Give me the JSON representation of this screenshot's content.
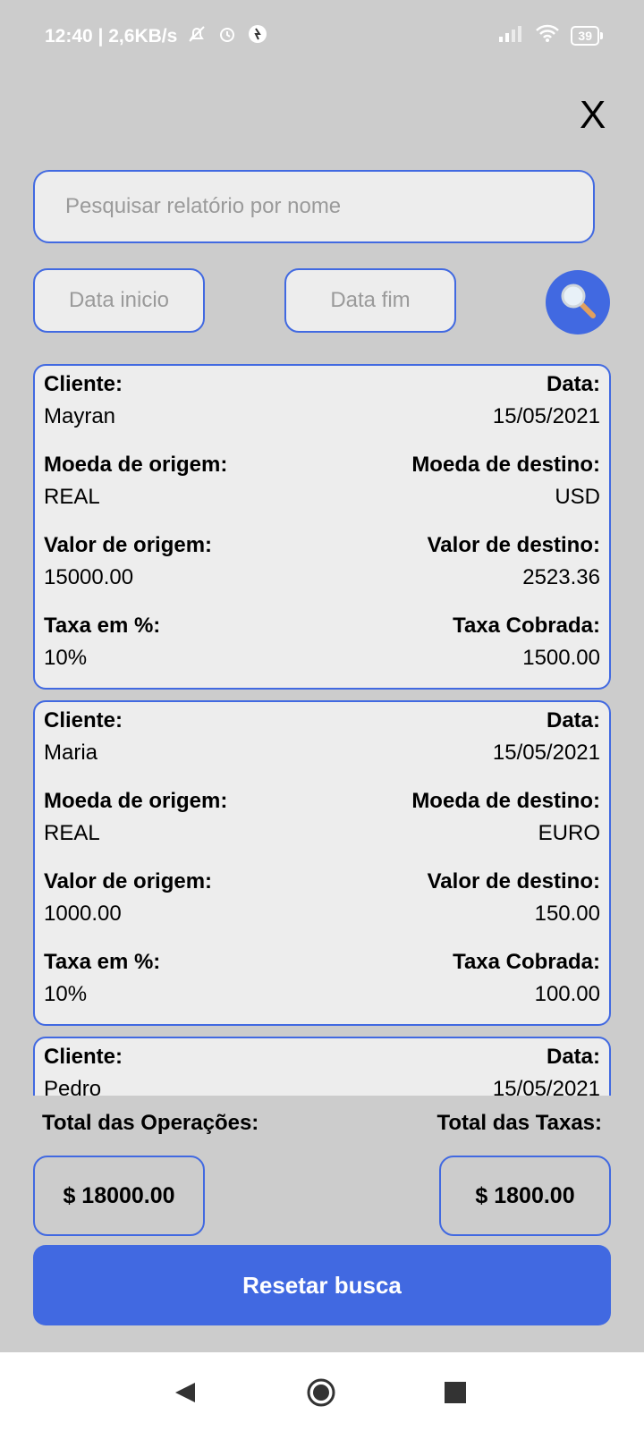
{
  "status_bar": {
    "time_speed": "12:40 | 2,6KB/s",
    "battery": "39"
  },
  "header": {
    "close_label": "X"
  },
  "search": {
    "placeholder": "Pesquisar relatório por nome",
    "start_date_placeholder": "Data inicio",
    "end_date_placeholder": "Data fim"
  },
  "labels": {
    "client": "Cliente:",
    "date": "Data:",
    "origin_currency": "Moeda de origem:",
    "dest_currency": "Moeda de destino:",
    "origin_value": "Valor de origem:",
    "dest_value": "Valor de destino:",
    "fee_percent": "Taxa em %:",
    "fee_charged": "Taxa Cobrada:"
  },
  "reports": [
    {
      "client": "Mayran",
      "date": "15/05/2021",
      "origin_currency": "REAL",
      "dest_currency": "USD",
      "origin_value": "15000.00",
      "dest_value": "2523.36",
      "fee_percent": "10%",
      "fee_charged": "1500.00"
    },
    {
      "client": "Maria",
      "date": "15/05/2021",
      "origin_currency": "REAL",
      "dest_currency": "EURO",
      "origin_value": "1000.00",
      "dest_value": "150.00",
      "fee_percent": "10%",
      "fee_charged": "100.00"
    },
    {
      "client": "Pedro",
      "date": "15/05/2021"
    }
  ],
  "totals": {
    "operations_label": "Total das Operações:",
    "fees_label": "Total das Taxas:",
    "operations_value": "$ 18000.00",
    "fees_value": "$ 1800.00"
  },
  "reset_button": "Resetar busca",
  "colors": {
    "accent": "#4169e1",
    "background": "#cccccc",
    "card": "#ededed"
  }
}
